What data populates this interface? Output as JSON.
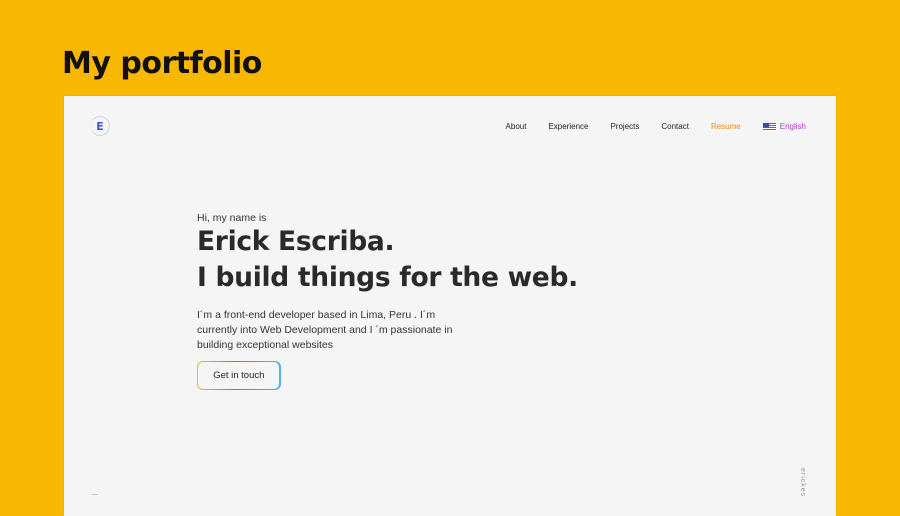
{
  "page": {
    "heading": "My portfolio",
    "background_color": "#f8b700"
  },
  "site": {
    "logo_letter": "E",
    "nav": {
      "items": [
        {
          "label": "About"
        },
        {
          "label": "Experience"
        },
        {
          "label": "Projects"
        },
        {
          "label": "Contact"
        }
      ],
      "resume_label": "Resume",
      "language_label": "English",
      "language_icon": "us-flag-icon"
    },
    "hero": {
      "greeting": "Hi, my name is",
      "name": "Erick Escriba.",
      "tagline": "I build things for the web.",
      "bio_lines": [
        "I´m a front-end developer based in Lima, Peru . I´m",
        "currently into Web Development and I ´m passionate in",
        "building exceptional websites"
      ],
      "cta_label": "Get in touch"
    },
    "side_handle": "erickes"
  },
  "colors": {
    "accent_resume": "#f08a1c",
    "accent_language": "#b43ad8",
    "logo_blue": "#3b57d9",
    "text_dark": "#2a2a2a"
  }
}
